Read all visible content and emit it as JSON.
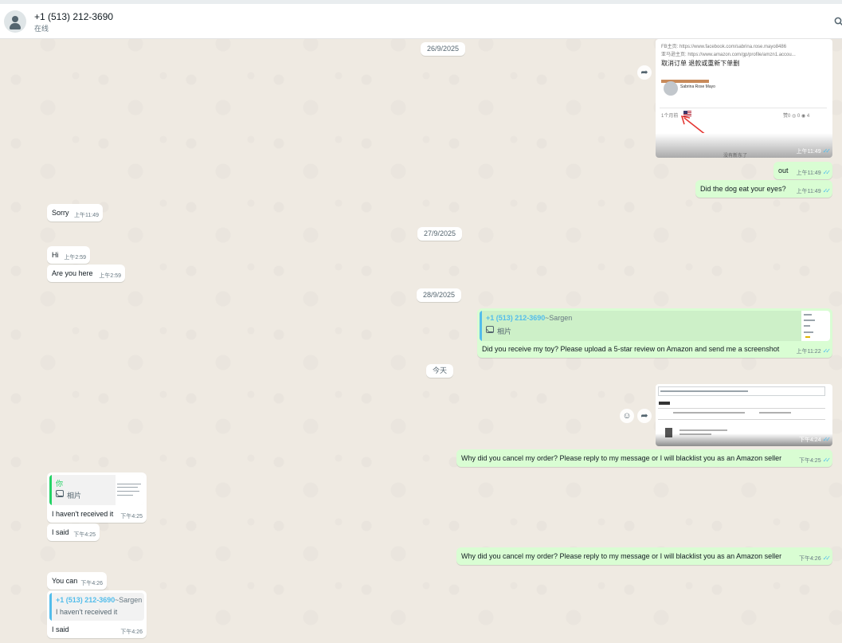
{
  "header": {
    "contact_name": "+1 (513) 212-3690",
    "status": "在线"
  },
  "colors": {
    "outgoing_bubble": "#d9fdd3",
    "incoming_bubble": "#ffffff",
    "read_ticks": "#53bdeb",
    "quote_name_blue": "#53bdeb",
    "quote_you_green": "#25d366"
  },
  "icons": {
    "avatar": "person-icon",
    "search": "search-icon",
    "forward": "forward-icon",
    "emoji": "emoji-icon",
    "photo": "photo-icon",
    "ticks": "double-check-icon"
  },
  "dates": {
    "d1": "26/9/2025",
    "d2": "27/9/2025",
    "d3": "28/9/2025",
    "d4": "今天"
  },
  "image1": {
    "line1": "FB主页: https://www.facebook.com/sabrina.rose.mayo8486",
    "line2": "亚马逊主页: https://www.amazon.com/gp/profile/amzn1.accou...",
    "line3": "取消订单 退款或重新下单删",
    "profile_name": "Sabrina Rose Mayo",
    "left_tag": "1个月前",
    "right_stats": "赞0 ◎ 0 ◉ 4",
    "bottom_text": "没有新东了",
    "time": "上午11:49"
  },
  "messages": {
    "m_out": {
      "text": "out",
      "time": "上午11:49"
    },
    "m_dog": {
      "text": "Did the dog eat your eyes?",
      "time": "上午11:49"
    },
    "m_sorry": {
      "text": "Sorry",
      "time": "上午11:49"
    },
    "m_hi": {
      "text": "Hi",
      "time": "上午2:59"
    },
    "m_here": {
      "text": "Are you here",
      "time": "上午2:59"
    },
    "m_toy": {
      "quote_name": "+1 (513) 212-3690",
      "quote_push": "~Sargen",
      "quote_label": "相片",
      "text": "Did you receive my toy? Please upload a 5-star review on Amazon and send me a screenshot",
      "time": "上午11:22"
    },
    "img2_time": "下午4:24",
    "m_cancel1": {
      "text": "Why did you cancel my order? Please reply to my message or I will blacklist you as an Amazon seller",
      "time": "下午4:25"
    },
    "m_recv": {
      "quote_name": "你",
      "quote_label": "相片",
      "text": "I haven't received it",
      "time": "下午4:25"
    },
    "m_said1": {
      "text": "I said",
      "time": "下午4:25"
    },
    "m_cancel2": {
      "text": "Why did you cancel my order? Please reply to my message or I will blacklist you as an Amazon seller",
      "time": "下午4:26"
    },
    "m_youcan": {
      "text": "You can",
      "time": "下午4:26"
    },
    "m_said2": {
      "quote_name": "+1 (513) 212-3690",
      "quote_push": "~Sargen",
      "quote_text": "I haven't received it",
      "text": "I said",
      "time": "下午4:26"
    }
  }
}
